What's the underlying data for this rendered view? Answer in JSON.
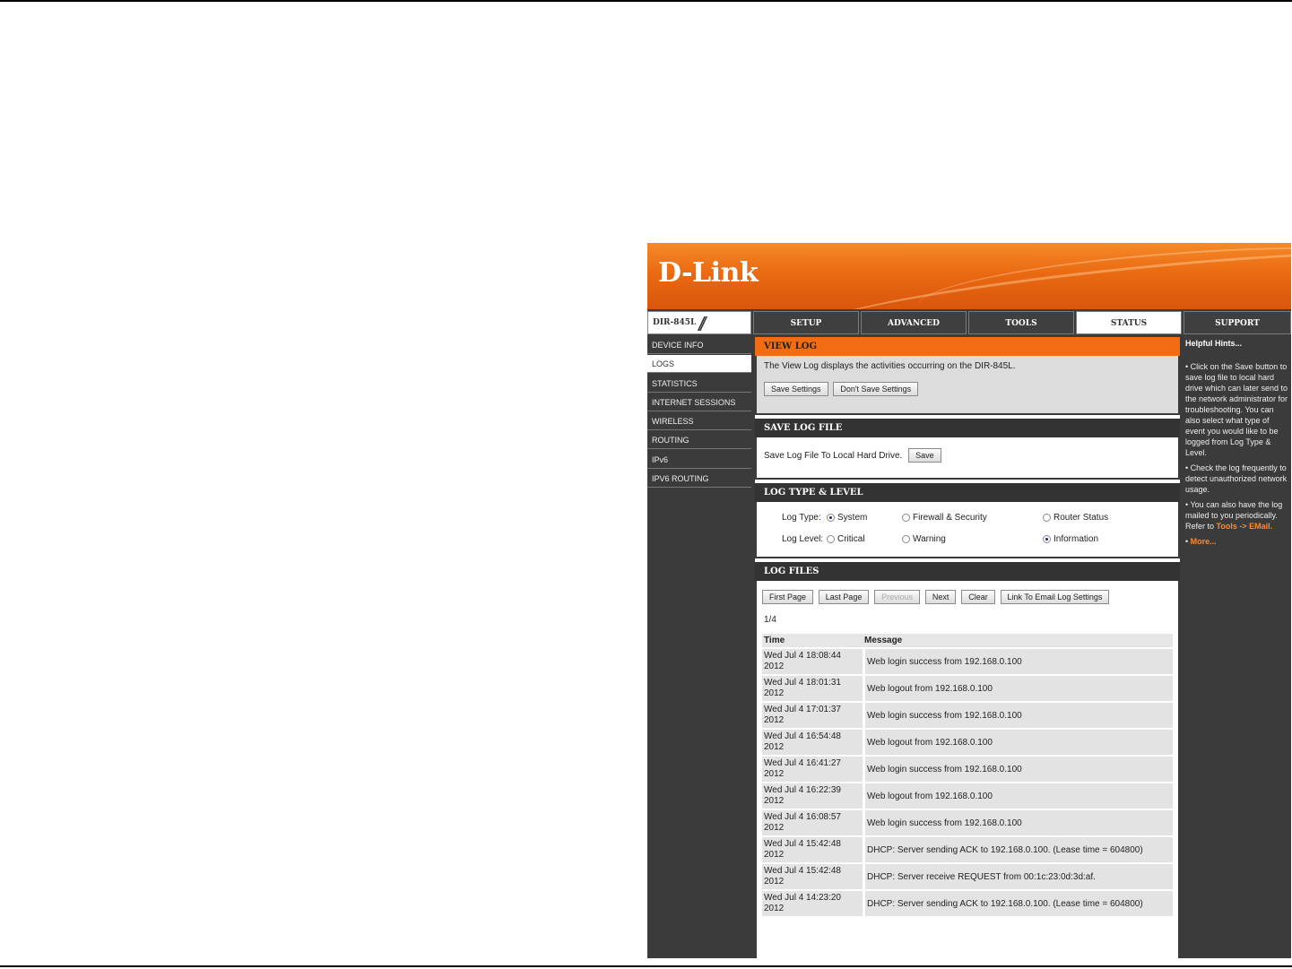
{
  "brand": {
    "logo": "D-Link",
    "model": "DIR-845L",
    "slashes": "//"
  },
  "tabs": [
    {
      "label": "SETUP"
    },
    {
      "label": "ADVANCED"
    },
    {
      "label": "TOOLS"
    },
    {
      "label": "STATUS"
    }
  ],
  "support_tab": "SUPPORT",
  "sidebar": {
    "items": [
      {
        "label": "DEVICE INFO"
      },
      {
        "label": "LOGS"
      },
      {
        "label": "STATISTICS"
      },
      {
        "label": "INTERNET SESSIONS"
      },
      {
        "label": "WIRELESS"
      },
      {
        "label": "ROUTING"
      },
      {
        "label": "IPv6"
      },
      {
        "label": "IPV6 ROUTING"
      }
    ]
  },
  "view_log": {
    "title": "VIEW LOG",
    "description": "The View Log displays the activities occurring on the DIR-845L.",
    "save_settings": "Save Settings",
    "dont_save_settings": "Don't Save Settings"
  },
  "save_log_file": {
    "title": "SAVE LOG FILE",
    "label": "Save Log File To Local Hard Drive.",
    "save_button": "Save"
  },
  "log_type_level": {
    "title": "LOG TYPE & LEVEL",
    "type_label": "Log Type:",
    "type_options": [
      "System",
      "Firewall & Security",
      "Router Status"
    ],
    "level_label": "Log Level:",
    "level_options": [
      "Critical",
      "Warning",
      "Information"
    ]
  },
  "log_files": {
    "title": "LOG FILES",
    "buttons": {
      "first_page": "First Page",
      "last_page": "Last Page",
      "previous": "Previous",
      "next": "Next",
      "clear": "Clear",
      "link_email": "Link To Email Log Settings"
    },
    "page_indicator": "1/4",
    "col_time": "Time",
    "col_message": "Message",
    "rows": [
      {
        "time1": "Wed Jul 4 18:08:44",
        "time2": "2012",
        "message": "Web login success from 192.168.0.100"
      },
      {
        "time1": "Wed Jul 4 18:01:31",
        "time2": "2012",
        "message": "Web logout from 192.168.0.100"
      },
      {
        "time1": "Wed Jul 4 17:01:37",
        "time2": "2012",
        "message": "Web login success from 192.168.0.100"
      },
      {
        "time1": "Wed Jul 4 16:54:48",
        "time2": "2012",
        "message": "Web logout from 192.168.0.100"
      },
      {
        "time1": "Wed Jul 4 16:41:27",
        "time2": "2012",
        "message": "Web login success from 192.168.0.100"
      },
      {
        "time1": "Wed Jul 4 16:22:39",
        "time2": "2012",
        "message": "Web logout from 192.168.0.100"
      },
      {
        "time1": "Wed Jul 4 16:08:57",
        "time2": "2012",
        "message": "Web login success from 192.168.0.100"
      },
      {
        "time1": "Wed Jul 4 15:42:48",
        "time2": "2012",
        "message": "DHCP: Server sending ACK to 192.168.0.100. (Lease time = 604800)"
      },
      {
        "time1": "Wed Jul 4 15:42:48",
        "time2": "2012",
        "message": "DHCP: Server receive REQUEST from 00:1c:23:0d:3d:af."
      },
      {
        "time1": "Wed Jul 4 14:23:20",
        "time2": "2012",
        "message": "DHCP: Server sending ACK to 192.168.0.100. (Lease time = 604800)"
      }
    ]
  },
  "hints": {
    "title": "Helpful Hints...",
    "hint1": "Click on the Save button to save log file to local hard drive which can later send to the network administrator for troubleshooting. You can also select what type of event you would like to be logged from Log Type & Level.",
    "hint2": "Check the log frequently to detect unauthorized network usage.",
    "hint3": "You can also have the log mailed to you periodically. Refer to",
    "hint3_link": "Tools -> EMail.",
    "more": "More..."
  },
  "colors": {
    "orange": "#f26c13",
    "dark": "#3b3b3b"
  }
}
